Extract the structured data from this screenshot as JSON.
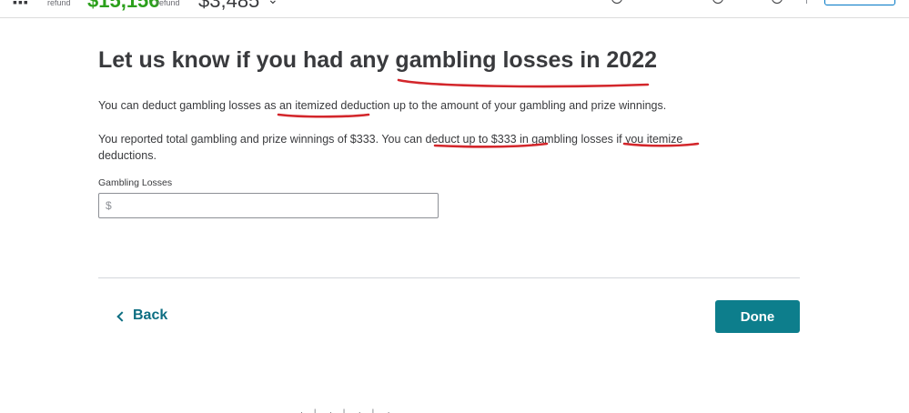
{
  "topbar": {
    "federal_label": "refund",
    "federal_amount": "$15,156",
    "state_label": "refund",
    "state_amount": "$3,485"
  },
  "page": {
    "title": "Let us know if you had any gambling losses in 2022",
    "intro": "You can deduct gambling losses as an itemized deduction up to the amount of your gambling and prize winnings.",
    "detail": "You reported total gambling and prize winnings of $333. You can deduct up to $333 in gambling losses if you itemize deductions."
  },
  "form": {
    "losses_label": "Gambling Losses",
    "currency_prefix": "$",
    "losses_value": ""
  },
  "nav": {
    "back_label": "Back",
    "done_label": "Done"
  },
  "colors": {
    "accent": "#0d7e8c",
    "annotation": "#d3262b",
    "refund_green": "#2ca01c"
  },
  "icons": {
    "back": "chevron-left-icon",
    "apps": "grid-icon"
  }
}
